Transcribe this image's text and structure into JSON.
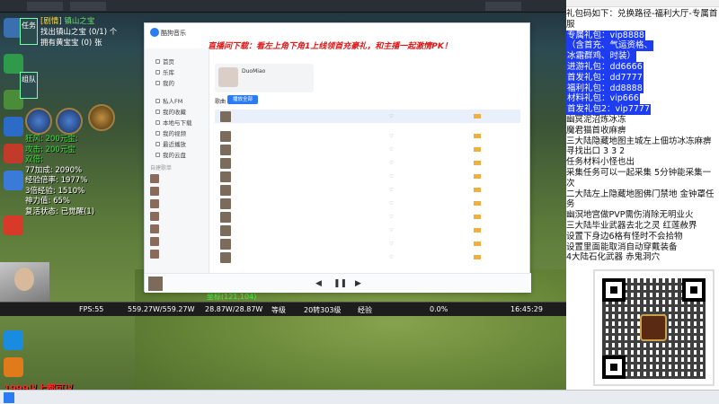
{
  "game": {
    "tabs": [
      "",
      "",
      ""
    ],
    "side_tabs": [
      "任务",
      "组队"
    ],
    "quest": {
      "prefix": "[剧情]",
      "title": "镇山之宝",
      "line1": "找出镇山之宝 (0/1) 个",
      "line2": "拥有黄宝宝 (0) 张"
    },
    "stats": {
      "line0": "狂风: 200元宝:",
      "line1": "攻击: 200元宝",
      "line2": "双倍:",
      "line3": "77加成: 2090%",
      "line4": "经验倍率: 1977%",
      "line5": "3倍经验: 1510%",
      "line6": "神力值: 65%",
      "line7": "复活状态: 已觉醒(1)"
    },
    "coord": "坐标(121,104)",
    "bottom": {
      "fps": "FPS:55",
      "hp": "559.27W/559.27W",
      "mp": "28.87W/28.87W",
      "level_label": "等级",
      "level": "20转303级",
      "exp_label": "经验",
      "exp": "0.0%",
      "time": "16:45:29"
    },
    "watermark": "1999以上都可以"
  },
  "music_app": {
    "title": "酷狗音乐",
    "marquee": "直播间下载：看左上角下角1上线领首充豪礼，和主播一起激情PK！",
    "nav": [
      "首页",
      "乐库",
      "我的",
      "私人FM",
      "我的收藏",
      "本地与下载",
      "我的视频",
      "最近播放",
      "我的云盘"
    ],
    "section_label": "自建歌单",
    "playlists": [
      "",
      "",
      "",
      "",
      "",
      "",
      ""
    ],
    "profile_name": "DuoMiao",
    "profile_sub": "",
    "songs_label": "歌曲",
    "play_all": "播放全部",
    "rows": [
      {
        "title": "",
        "album": "",
        "dur": "",
        "selected": true
      },
      {
        "title": "",
        "album": "",
        "dur": "",
        "selected": false
      },
      {
        "title": "",
        "album": "",
        "dur": "",
        "selected": false
      },
      {
        "title": "",
        "album": "",
        "dur": "",
        "selected": false
      },
      {
        "title": "",
        "album": "",
        "dur": "",
        "selected": false
      },
      {
        "title": "",
        "album": "",
        "dur": "",
        "selected": false
      },
      {
        "title": "",
        "album": "",
        "dur": "",
        "selected": false
      },
      {
        "title": "",
        "album": "",
        "dur": "",
        "selected": false
      },
      {
        "title": "",
        "album": "",
        "dur": "",
        "selected": false
      },
      {
        "title": "",
        "album": "",
        "dur": "",
        "selected": false
      },
      {
        "title": "",
        "album": "",
        "dur": "",
        "selected": false
      }
    ],
    "player_text": ""
  },
  "panel": {
    "lines": [
      {
        "text": "礼包码如下：兑换路径-福利大厅-专属首服",
        "hl": false
      },
      {
        "text": "专属礼包：vip8888",
        "hl": true
      },
      {
        "text": "（含首充、气运资格、",
        "hl": true
      },
      {
        "text": "冰霜群鸡、时装）",
        "hl": true
      },
      {
        "text": "进游礼包：dd6666",
        "hl": true
      },
      {
        "text": "首发礼包：dd7777",
        "hl": true
      },
      {
        "text": "福利礼包：dd8888",
        "hl": true
      },
      {
        "text": "材料礼包：vip666",
        "hl": true
      },
      {
        "text": "首发礼包2：vip7777",
        "hl": true
      },
      {
        "text": "幽冥泥沼炼冰冻",
        "hl": false
      },
      {
        "text": "魔君猫首收麻痹",
        "hl": false
      },
      {
        "text": "三大陆隐藏地图主城左上佃坊冰冻麻痹",
        "hl": false
      },
      {
        "text": "寻找出口 3 3 2",
        "hl": false
      },
      {
        "text": "任务材料小怪也出",
        "hl": false
      },
      {
        "text": "采集任务可以一起采集 5分钟能采集一次",
        "hl": false
      },
      {
        "text": "二大陆左上隐藏地图佛门禁地 金钟罩任务",
        "hl": false
      },
      {
        "text": "幽溟地宫做PVP需伤消除无明业火",
        "hl": false
      },
      {
        "text": "三大陆毕业武器去北之灵 红莲赦界",
        "hl": false
      },
      {
        "text": "设置下身边6格有怪时不会拾物",
        "hl": false
      },
      {
        "text": "设置里面能取消自动穿戴装备",
        "hl": false
      },
      {
        "text": "4大陆石化武器 赤鬼洞穴",
        "hl": false
      }
    ]
  },
  "colors": {
    "accent": "#2a7bf4",
    "highlight": "#1e3cf0",
    "warning": "#e01818",
    "stat_green": "#38e038"
  }
}
